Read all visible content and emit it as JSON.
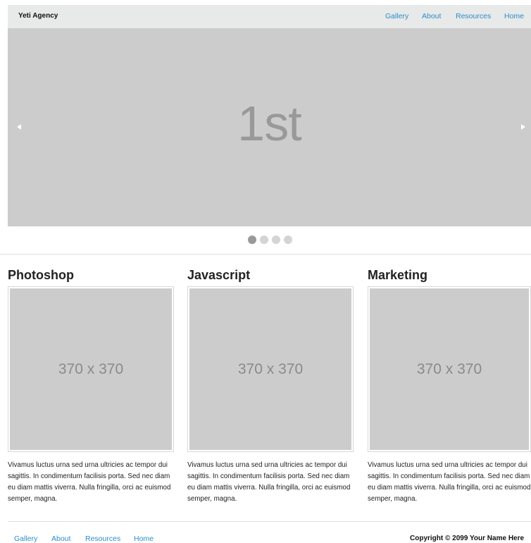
{
  "header": {
    "brand": "Yeti Agency",
    "nav": [
      "Gallery",
      "About",
      "Resources",
      "Home"
    ]
  },
  "slider": {
    "slide_text": "1st",
    "total_slides": 4,
    "active_index": 0
  },
  "columns": [
    {
      "title": "Photoshop",
      "image_label": "370 x 370",
      "text": "Vivamus luctus urna sed urna ultricies ac tempor dui sagittis. In condimentum facilisis porta. Sed nec diam eu diam mattis viverra. Nulla fringilla, orci ac euismod semper, magna."
    },
    {
      "title": "Javascript",
      "image_label": "370 x 370",
      "text": "Vivamus luctus urna sed urna ultricies ac tempor dui sagittis. In condimentum facilisis porta. Sed nec diam eu diam mattis viverra. Nulla fringilla, orci ac euismod semper, magna."
    },
    {
      "title": "Marketing",
      "image_label": "370 x 370",
      "text": "Vivamus luctus urna sed urna ultricies ac tempor dui sagittis. In condimentum facilisis porta. Sed nec diam eu diam mattis viverra. Nulla fringilla, orci ac euismod semper, magna."
    }
  ],
  "footer": {
    "nav": [
      "Gallery",
      "About",
      "Resources",
      "Home"
    ],
    "copyright": "Copyright © 2099 Your Name Here"
  },
  "colors": {
    "link": "#2a8ec9",
    "topbar": "#e8e9e9",
    "placeholder": "#cccccc"
  }
}
